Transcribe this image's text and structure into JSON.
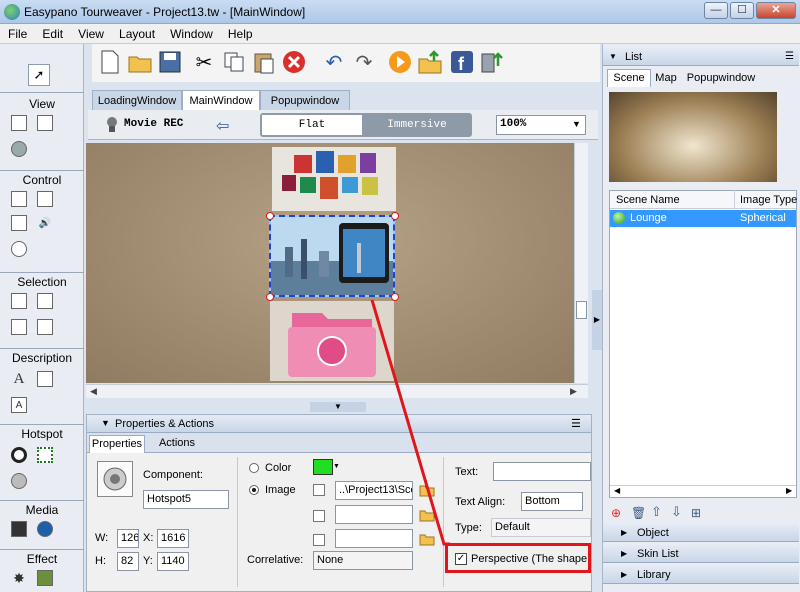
{
  "window": {
    "title": "Easypano Tourweaver - Project13.tw - [MainWindow]",
    "min": "—",
    "max": "☐",
    "close": "✕"
  },
  "menu": [
    "File",
    "Edit",
    "View",
    "Layout",
    "Window",
    "Help"
  ],
  "toolbar_icons": [
    "new-file",
    "open-folder",
    "save",
    "cut",
    "copy",
    "paste",
    "delete",
    "undo",
    "redo",
    "play",
    "publish",
    "facebook",
    "export"
  ],
  "left": {
    "view": "View",
    "control": "Control",
    "selection": "Selection",
    "description": "Description",
    "hotspot": "Hotspot",
    "media": "Media",
    "effect": "Effect"
  },
  "tabs": [
    {
      "label": "LoadingWindow"
    },
    {
      "label": "MainWindow"
    },
    {
      "label": "Popupwindow"
    }
  ],
  "subbar": {
    "movie_rec": "Movie REC",
    "flat": "Flat",
    "immersive": "Immersive",
    "zoom": "100%"
  },
  "props": {
    "header": "Properties & Actions",
    "tab_properties": "Properties",
    "tab_actions": "Actions",
    "component_label": "Component:",
    "component_value": "Hotspot5",
    "w_label": "W:",
    "w_value": "126",
    "x_label": "X:",
    "x_value": "1616",
    "h_label": "H:",
    "h_value": "82",
    "y_label": "Y:",
    "y_value": "1140",
    "color_label": "Color",
    "image_label": "Image",
    "image_path": "..\\Project13\\Sce",
    "correlative_label": "Correlative:",
    "correlative_value": "None",
    "text_label": "Text:",
    "text_align_label": "Text Align:",
    "text_align_value": "Bottom",
    "type_label": "Type:",
    "type_value": "Default",
    "perspective_label": "Perspective (The shape"
  },
  "right": {
    "list_title": "List",
    "tab_scene": "Scene",
    "tab_map": "Map",
    "tab_popup": "Popupwindow",
    "col_scene": "Scene Name",
    "col_type": "Image Type",
    "row_name": "Lounge",
    "row_type": "Spherical",
    "object": "Object",
    "skin_list": "Skin List",
    "library": "Library"
  },
  "colors": {
    "accent": "#3399ff",
    "highlight": "#e0161a",
    "selected_row": "#3399ff"
  }
}
